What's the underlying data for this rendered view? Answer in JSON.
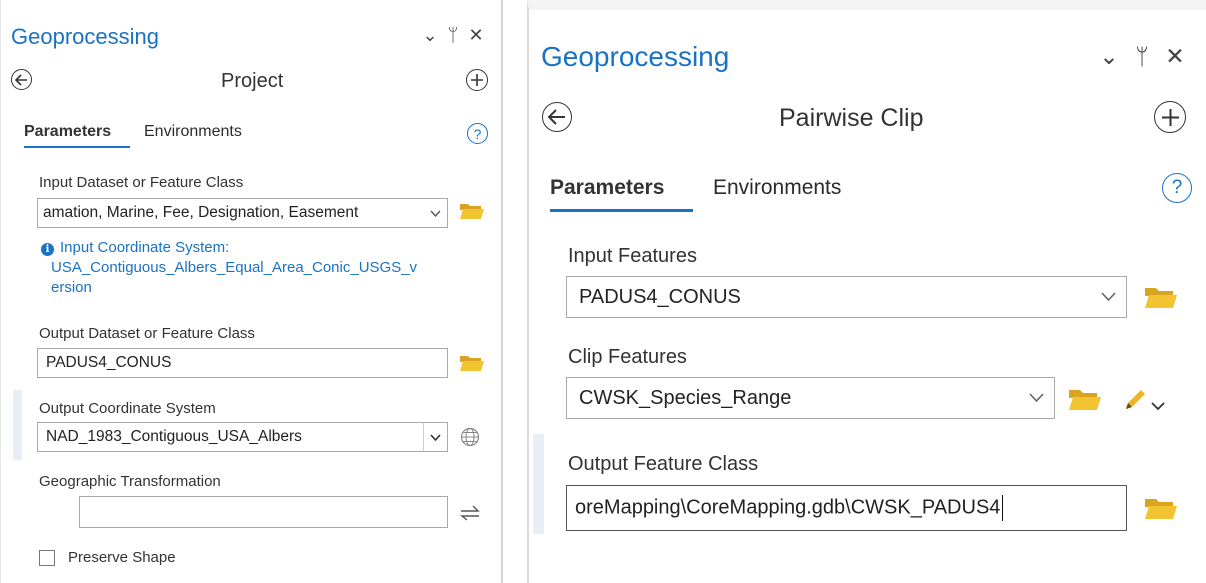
{
  "left_panel": {
    "title": "Geoprocessing",
    "controls": {
      "collapse": "⌄",
      "pin": "ᛘ",
      "close": "✕"
    },
    "back_icon": "back-circle-arrow",
    "tool_name": "Project",
    "add_icon": "plus-circle",
    "tabs": [
      {
        "label": "Parameters",
        "active": true
      },
      {
        "label": "Environments",
        "active": false
      }
    ],
    "help": "?",
    "params": {
      "input_label": "Input Dataset or Feature Class",
      "input_value": "amation, Marine, Fee, Designation, Easement",
      "info_line1": "Input Coordinate System:",
      "info_line2": "USA_Contiguous_Albers_Equal_Area_Conic_USGS_v",
      "info_line3": "ersion",
      "output_label": "Output Dataset or Feature Class",
      "output_value": "PADUS4_CONUS",
      "ocs_label": "Output Coordinate System",
      "ocs_value": "NAD_1983_Contiguous_USA_Albers",
      "gt_label": "Geographic Transformation",
      "gt_value": "",
      "preserve_label": "Preserve Shape",
      "preserve_checked": false
    }
  },
  "right_panel": {
    "title": "Geoprocessing",
    "controls": {
      "collapse": "⌄",
      "pin": "ᛘ",
      "close": "✕"
    },
    "back_icon": "back-circle-arrow",
    "tool_name": "Pairwise Clip",
    "add_icon": "plus-circle",
    "tabs": [
      {
        "label": "Parameters",
        "active": true
      },
      {
        "label": "Environments",
        "active": false
      }
    ],
    "help": "?",
    "params": {
      "input_label": "Input Features",
      "input_value": "PADUS4_CONUS",
      "clip_label": "Clip Features",
      "clip_value": "CWSK_Species_Range",
      "output_label": "Output Feature Class",
      "output_value": "oreMapping\\CoreMapping.gdb\\CWSK_PADUS4"
    }
  },
  "colors": {
    "accent": "#1b72c2",
    "folder": "#f2c431",
    "pencil": "#e8a400"
  }
}
